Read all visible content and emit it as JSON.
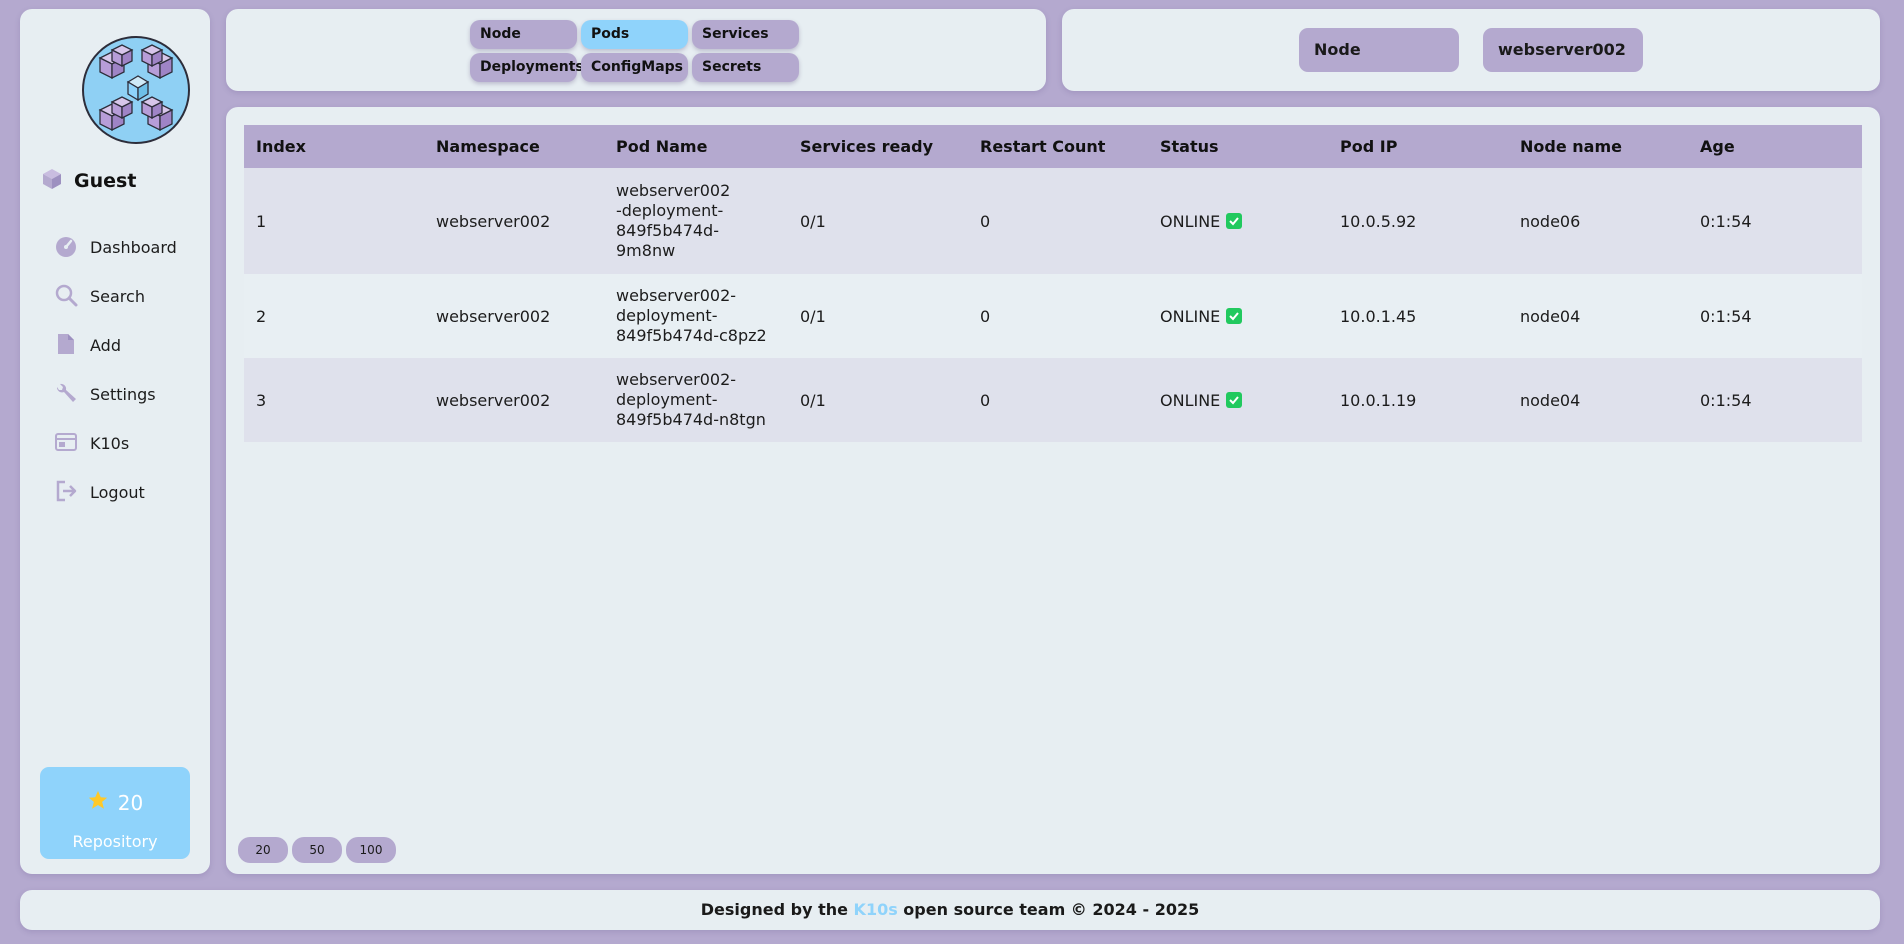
{
  "colors": {
    "background": "#b4a9cf",
    "panel": "#e7eef2",
    "accent": "#8fd3fb",
    "chip": "#b4a9cf",
    "online": "#21c95e",
    "star": "#ffc928"
  },
  "sidebar": {
    "logo_icon": "cubes-logo",
    "user": {
      "icon": "cube-icon",
      "name": "Guest"
    },
    "items": [
      {
        "label": "Dashboard",
        "icon": "gauge-icon"
      },
      {
        "label": "Search",
        "icon": "search-icon"
      },
      {
        "label": "Add",
        "icon": "file-icon"
      },
      {
        "label": "Settings",
        "icon": "wrench-icon"
      },
      {
        "label": "K10s",
        "icon": "window-icon"
      },
      {
        "label": "Logout",
        "icon": "logout-icon"
      }
    ],
    "repository": {
      "stars": "20",
      "label": "Repository",
      "icon": "star-icon"
    }
  },
  "tabs": [
    {
      "label": "Node",
      "active": false
    },
    {
      "label": "Pods",
      "active": true
    },
    {
      "label": "Services",
      "active": false
    },
    {
      "label": "Deployments",
      "active": false
    },
    {
      "label": "ConfigMaps",
      "active": false
    },
    {
      "label": "Secrets",
      "active": false
    }
  ],
  "filters": {
    "node_label": "Node",
    "namespace_value": "webserver002"
  },
  "table": {
    "columns": [
      "Index",
      "Namespace",
      "Pod Name",
      "Services ready",
      "Restart Count",
      "Status",
      "Pod IP",
      "Node name",
      "Age"
    ],
    "rows": [
      {
        "index": "1",
        "namespace": "webserver002",
        "pod_name": "webserver002-deployment-849f5b474d-9m8nw",
        "services_ready": "0/1",
        "restart_count": "0",
        "status": "ONLINE",
        "pod_ip": "10.0.5.92",
        "node_name": "node06",
        "age": "0:1:54"
      },
      {
        "index": "2",
        "namespace": "webserver002",
        "pod_name": "webserver002-deployment-849f5b474d-c8pz2",
        "services_ready": "0/1",
        "restart_count": "0",
        "status": "ONLINE",
        "pod_ip": "10.0.1.45",
        "node_name": "node04",
        "age": "0:1:54"
      },
      {
        "index": "3",
        "namespace": "webserver002",
        "pod_name": "webserver002-deployment-849f5b474d-n8tgn",
        "services_ready": "0/1",
        "restart_count": "0",
        "status": "ONLINE",
        "pod_ip": "10.0.1.19",
        "node_name": "node04",
        "age": "0:1:54"
      }
    ]
  },
  "pagination": [
    "20",
    "50",
    "100"
  ],
  "footer": {
    "prefix": "Designed by the ",
    "brand": "K10s",
    "suffix": " open source team © 2024 - 2025"
  }
}
